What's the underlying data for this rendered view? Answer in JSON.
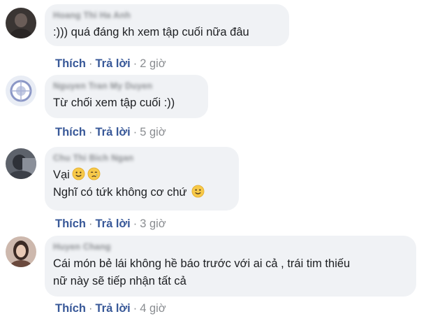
{
  "actions": {
    "like": "Thích",
    "reply": "Trả lời",
    "separator": "·"
  },
  "comments": [
    {
      "author": "Hoang Thi Ha Anh",
      "lines": [
        ":))) quá đáng kh xem tập cuối nữa đâu"
      ],
      "time": "2 giờ"
    },
    {
      "author": "Nguyen Tran My Duyen",
      "lines": [
        "Từ chối xem tập cuối :))"
      ],
      "time": "5 giờ"
    },
    {
      "author": "Chu Thi Bich Ngan",
      "lines": [
        "Vại",
        "Nghĩ có tứk không cơ chứ"
      ],
      "emojis": [
        "slightly-smiling-face",
        "crying-face",
        "slightly-smiling-face"
      ],
      "time": "3 giờ"
    },
    {
      "author": "Huyen Chang",
      "lines": [
        "Cái món bẻ lái không hề báo trước với ai cả , trái tim thiếu",
        "nữ này sẽ tiếp nhận tất cả"
      ],
      "time": "4 giờ"
    }
  ],
  "colors": {
    "bubble": "#f0f2f5",
    "link": "#385898",
    "meta": "#8a8d91",
    "text": "#1c1e21"
  }
}
